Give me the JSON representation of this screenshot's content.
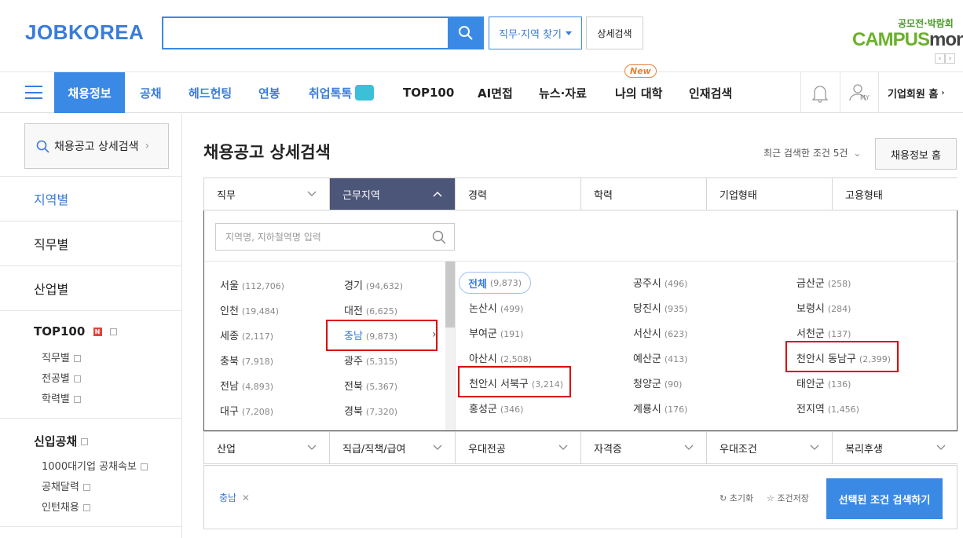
{
  "header": {
    "logo": "JOBKOREA",
    "search_placeholder": "",
    "jobarea_btn": "직무·지역 찾기",
    "detail_btn": "상세검색",
    "promo_top": "공모전·박람회",
    "promo_logo_a": "CAMPUS",
    "promo_logo_b": "mon"
  },
  "nav": {
    "items": [
      "채용정보",
      "공채",
      "헤드헌팅",
      "연봉",
      "취업톡톡",
      "TOP100",
      "AI면접",
      "뉴스·자료",
      "나의 대학",
      "인재검색"
    ],
    "new_badge": "New",
    "my_label": "MY",
    "corp_home": "기업회원 홈"
  },
  "sidebar": {
    "search_label": "채용공고 상세검색",
    "by_region": "지역별",
    "by_job": "직무별",
    "by_industry": "산업별",
    "top100": "TOP100",
    "top100_badge": "N",
    "top100_subs": [
      "직무별",
      "전공별",
      "학력별"
    ],
    "newgrad": "신입공채",
    "newgrad_subs": [
      "1000대기업 공채속보",
      "공채달력",
      "인턴채용"
    ]
  },
  "main": {
    "title": "채용공고 상세검색",
    "recent": "최근 검색한 조건 5건",
    "home_btn": "채용정보 홈",
    "tabs_top": [
      "직무",
      "근무지역",
      "경력",
      "학력",
      "기업형태",
      "고용형태"
    ],
    "tabs_bottom": [
      "산업",
      "직급/직책/급여",
      "우대전공",
      "자격증",
      "우대조건",
      "복리후생"
    ],
    "region_input_placeholder": "지역명, 지하철역명 입력",
    "left_regions": [
      {
        "name": "서울",
        "cnt": "(112,706)"
      },
      {
        "name": "경기",
        "cnt": "(94,632)"
      },
      {
        "name": "인천",
        "cnt": "(19,484)"
      },
      {
        "name": "대전",
        "cnt": "(6,625)"
      },
      {
        "name": "세종",
        "cnt": "(2,117)"
      },
      {
        "name": "충남",
        "cnt": "(9,873)"
      },
      {
        "name": "충북",
        "cnt": "(7,918)"
      },
      {
        "name": "광주",
        "cnt": "(5,315)"
      },
      {
        "name": "전남",
        "cnt": "(4,893)"
      },
      {
        "name": "전북",
        "cnt": "(5,367)"
      },
      {
        "name": "대구",
        "cnt": "(7,208)"
      },
      {
        "name": "경북",
        "cnt": "(7,320)"
      }
    ],
    "sub_all": {
      "name": "전체",
      "cnt": "(9,873)"
    },
    "sub_regions": [
      {
        "name": "공주시",
        "cnt": "(496)"
      },
      {
        "name": "금산군",
        "cnt": "(258)"
      },
      {
        "name": "논산시",
        "cnt": "(499)"
      },
      {
        "name": "당진시",
        "cnt": "(935)"
      },
      {
        "name": "보령시",
        "cnt": "(284)"
      },
      {
        "name": "부여군",
        "cnt": "(191)"
      },
      {
        "name": "서산시",
        "cnt": "(623)"
      },
      {
        "name": "서천군",
        "cnt": "(137)"
      },
      {
        "name": "아산시",
        "cnt": "(2,508)"
      },
      {
        "name": "예산군",
        "cnt": "(413)"
      },
      {
        "name": "천안시 동남구",
        "cnt": "(2,399)"
      },
      {
        "name": "천안시 서북구",
        "cnt": "(3,214)"
      },
      {
        "name": "청양군",
        "cnt": "(90)"
      },
      {
        "name": "태안군",
        "cnt": "(136)"
      },
      {
        "name": "홍성군",
        "cnt": "(346)"
      },
      {
        "name": "계룡시",
        "cnt": "(176)"
      },
      {
        "name": "전지역",
        "cnt": "(1,456)"
      }
    ],
    "selected_tag": "충남",
    "reset": "초기화",
    "save": "조건저장",
    "go_btn": "선택된 조건 검색하기"
  },
  "colors": {
    "accent": "#3a8ae5",
    "active_tab": "#4c5678",
    "highlight": "#d90000"
  }
}
